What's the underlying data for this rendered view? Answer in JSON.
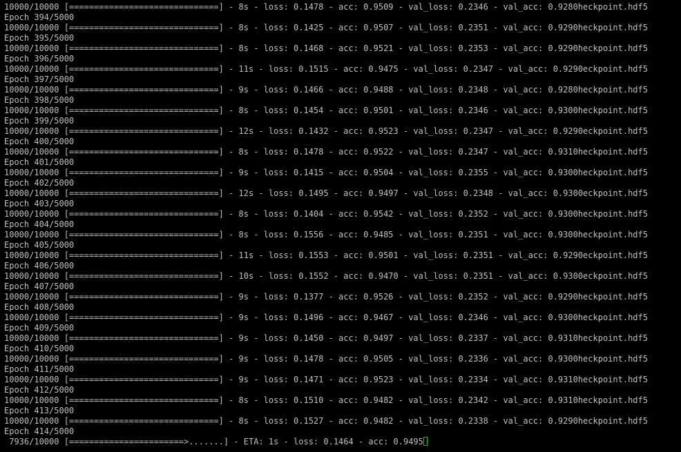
{
  "terminal": {
    "lines": [
      "10000/10000 [==============================] - 8s - loss: 0.1478 - acc: 0.9509 - val_loss: 0.2346 - val_acc: 0.9280heckpoint.hdf5",
      "Epoch 394/5000",
      "10000/10000 [==============================] - 8s - loss: 0.1425 - acc: 0.9507 - val_loss: 0.2351 - val_acc: 0.9290heckpoint.hdf5",
      "Epoch 395/5000",
      "10000/10000 [==============================] - 8s - loss: 0.1468 - acc: 0.9521 - val_loss: 0.2353 - val_acc: 0.9290heckpoint.hdf5",
      "Epoch 396/5000",
      "10000/10000 [==============================] - 11s - loss: 0.1515 - acc: 0.9475 - val_loss: 0.2347 - val_acc: 0.9290eckpoint.hdf5",
      "Epoch 397/5000",
      "10000/10000 [==============================] - 9s - loss: 0.1466 - acc: 0.9488 - val_loss: 0.2348 - val_acc: 0.9280heckpoint.hdf5",
      "Epoch 398/5000",
      "10000/10000 [==============================] - 8s - loss: 0.1454 - acc: 0.9501 - val_loss: 0.2346 - val_acc: 0.9300heckpoint.hdf5",
      "Epoch 399/5000",
      "10000/10000 [==============================] - 12s - loss: 0.1432 - acc: 0.9523 - val_loss: 0.2347 - val_acc: 0.9290eckpoint.hdf5",
      "Epoch 400/5000",
      "10000/10000 [==============================] - 8s - loss: 0.1478 - acc: 0.9522 - val_loss: 0.2347 - val_acc: 0.9310heckpoint.hdf5",
      "Epoch 401/5000",
      "10000/10000 [==============================] - 9s - loss: 0.1415 - acc: 0.9504 - val_loss: 0.2355 - val_acc: 0.9300heckpoint.hdf5",
      "Epoch 402/5000",
      "10000/10000 [==============================] - 12s - loss: 0.1495 - acc: 0.9497 - val_loss: 0.2348 - val_acc: 0.9300eckpoint.hdf5",
      "Epoch 403/5000",
      "10000/10000 [==============================] - 8s - loss: 0.1404 - acc: 0.9542 - val_loss: 0.2352 - val_acc: 0.9300heckpoint.hdf5",
      "Epoch 404/5000",
      "10000/10000 [==============================] - 8s - loss: 0.1556 - acc: 0.9485 - val_loss: 0.2351 - val_acc: 0.9300heckpoint.hdf5",
      "Epoch 405/5000",
      "10000/10000 [==============================] - 11s - loss: 0.1553 - acc: 0.9501 - val_loss: 0.2351 - val_acc: 0.9290eckpoint.hdf5",
      "Epoch 406/5000",
      "10000/10000 [==============================] - 10s - loss: 0.1552 - acc: 0.9470 - val_loss: 0.2351 - val_acc: 0.9300eckpoint.hdf5",
      "Epoch 407/5000",
      "10000/10000 [==============================] - 9s - loss: 0.1377 - acc: 0.9526 - val_loss: 0.2352 - val_acc: 0.9290heckpoint.hdf5",
      "Epoch 408/5000",
      "10000/10000 [==============================] - 9s - loss: 0.1496 - acc: 0.9467 - val_loss: 0.2346 - val_acc: 0.9300heckpoint.hdf5",
      "Epoch 409/5000",
      "10000/10000 [==============================] - 9s - loss: 0.1450 - acc: 0.9497 - val_loss: 0.2337 - val_acc: 0.9310heckpoint.hdf5",
      "Epoch 410/5000",
      "10000/10000 [==============================] - 9s - loss: 0.1478 - acc: 0.9505 - val_loss: 0.2336 - val_acc: 0.9300heckpoint.hdf5",
      "Epoch 411/5000",
      "10000/10000 [==============================] - 9s - loss: 0.1471 - acc: 0.9523 - val_loss: 0.2334 - val_acc: 0.9310heckpoint.hdf5",
      "Epoch 412/5000",
      "10000/10000 [==============================] - 8s - loss: 0.1510 - acc: 0.9482 - val_loss: 0.2342 - val_acc: 0.9310heckpoint.hdf5",
      "Epoch 413/5000",
      "10000/10000 [==============================] - 8s - loss: 0.1527 - acc: 0.9482 - val_loss: 0.2338 - val_acc: 0.9290heckpoint.hdf5",
      "Epoch 414/5000"
    ],
    "progress_line": " 7936/10000 [=======================>.......] - ETA: 1s - loss: 0.1464 - acc: 0.9495",
    "cursor_icon": "block-cursor-icon",
    "colors": {
      "background": "#000000",
      "text": "#c0c0c0",
      "cursor": "#00d000"
    }
  }
}
